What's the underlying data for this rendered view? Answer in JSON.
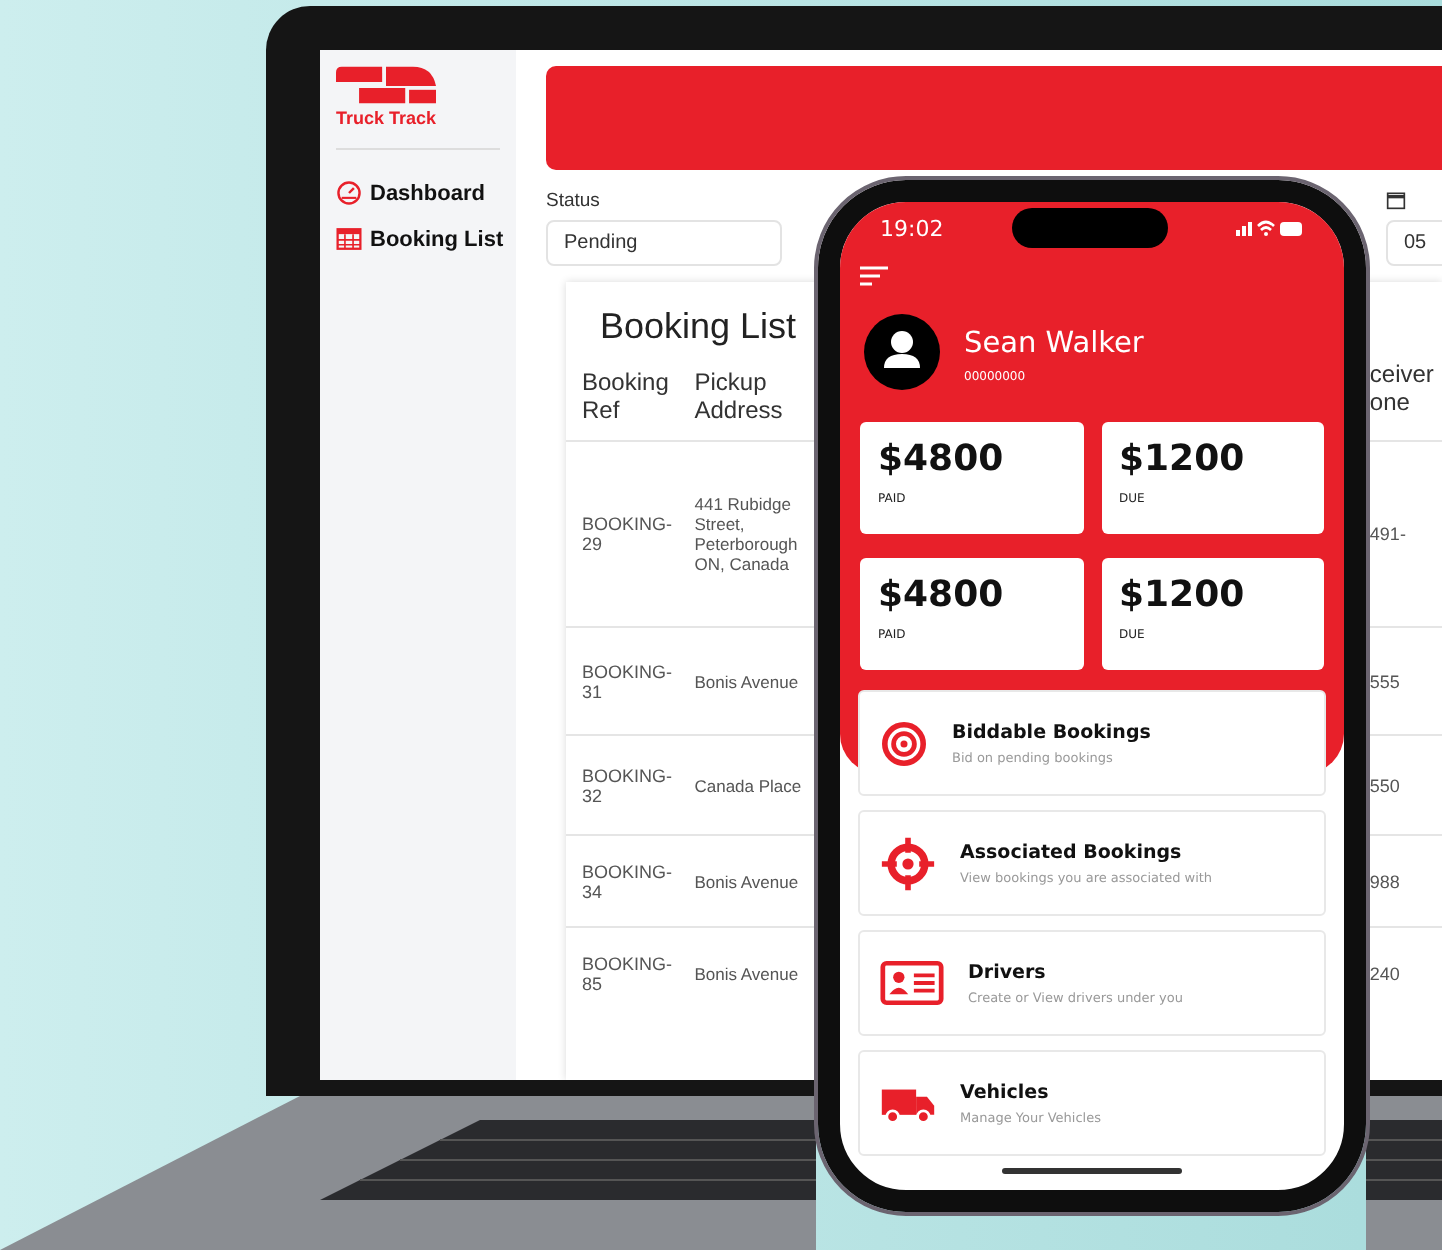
{
  "laptop": {
    "logo": {
      "text": "Truck Track"
    },
    "sidebar": {
      "items": [
        {
          "kind": "gauge",
          "label": "Dashboard"
        },
        {
          "kind": "table",
          "label": "Booking List"
        }
      ]
    },
    "filters": {
      "status_label": "Status",
      "status_value": "Pending",
      "date_value": "05"
    },
    "table": {
      "title": "Booking List",
      "columns": [
        "Booking Ref",
        "Pickup Address",
        "ceiver one"
      ],
      "rows": [
        {
          "ref": "BOOKING-29",
          "pickup": "441 Rubidge Street, Peterborough ON, Canada",
          "column_3": "491-"
        },
        {
          "ref": "BOOKING-31",
          "pickup": "Bonis Avenue",
          "column_3": "555"
        },
        {
          "ref": "BOOKING-32",
          "pickup": "Canada Place",
          "column_3": "550"
        },
        {
          "ref": "BOOKING-34",
          "pickup": "Bonis Avenue",
          "column_3": "988"
        },
        {
          "ref": "BOOKING-85",
          "pickup": "Bonis Avenue",
          "column_3": "240"
        }
      ]
    }
  },
  "phone": {
    "time": "19:02",
    "user": {
      "name": "Sean Walker",
      "id": "00000000"
    },
    "stats": [
      {
        "amount": "$4800",
        "label": "PAID"
      },
      {
        "amount": "$1200",
        "label": "DUE"
      },
      {
        "amount": "$4800",
        "label": "PAID"
      },
      {
        "amount": "$1200",
        "label": "DUE"
      }
    ],
    "menu": [
      {
        "kind": "target",
        "title": "Biddable Bookings",
        "subtitle": "Bid on pending bookings"
      },
      {
        "kind": "crosshair",
        "title": "Associated Bookings",
        "subtitle": "View bookings you are associated with"
      },
      {
        "kind": "id-card",
        "title": "Drivers",
        "subtitle": "Create or View drivers under you"
      },
      {
        "kind": "truck",
        "title": "Vehicles",
        "subtitle": "Manage Your Vehicles"
      }
    ]
  }
}
